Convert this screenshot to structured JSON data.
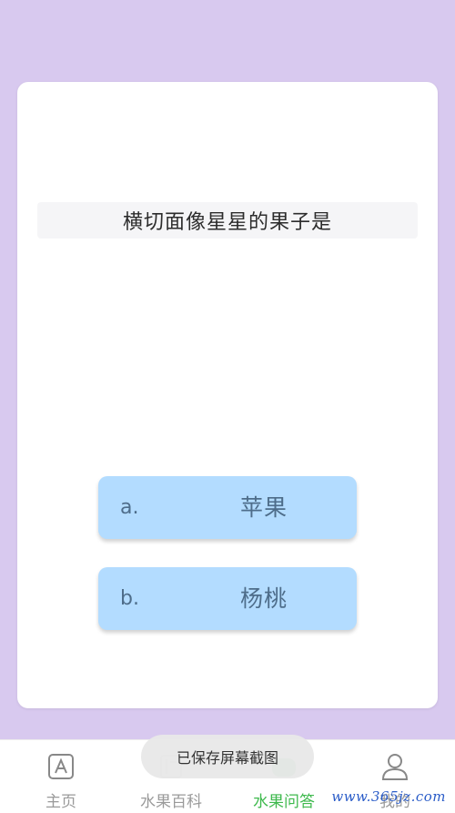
{
  "question": {
    "text": "横切面像星星的果子是"
  },
  "options": [
    {
      "letter": "a.",
      "text": "苹果"
    },
    {
      "letter": "b.",
      "text": "杨桃"
    }
  ],
  "tabbar": {
    "items": [
      {
        "label": "主页",
        "icon": "home-a-icon",
        "active": false
      },
      {
        "label": "水果百科",
        "icon": "book-icon",
        "active": false
      },
      {
        "label": "水果问答",
        "icon": "qa-icon",
        "active": true
      },
      {
        "label": "我的",
        "icon": "user-icon",
        "active": false
      }
    ]
  },
  "toast": {
    "text": "已保存屏幕截图"
  },
  "watermark": {
    "text": "www.365jz.com"
  },
  "colors": {
    "background": "#d8c9ef",
    "option_bg": "#b3dcff",
    "active_tab": "#3eb94d",
    "inactive_tab": "#9a9a9a"
  }
}
